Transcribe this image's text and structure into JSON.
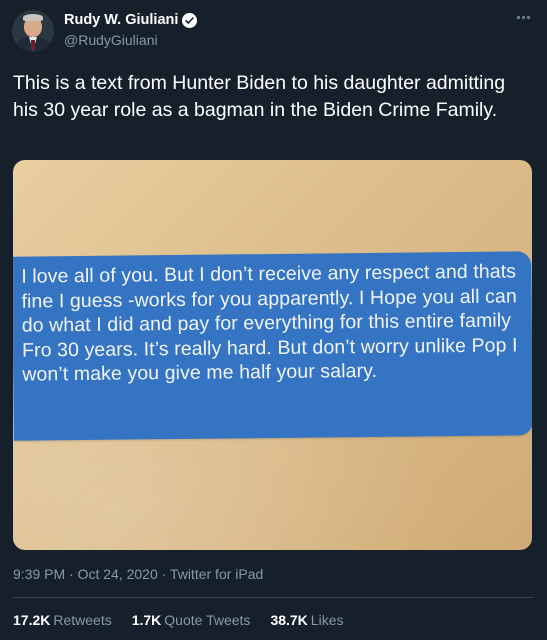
{
  "author": {
    "display_name": "Rudy W. Giuliani",
    "handle": "@RudyGiuliani",
    "verified": true
  },
  "tweet": {
    "text": "This is a text from Hunter Biden to his daughter admitting his 30 year role as a bagman in the Biden Crime Family.",
    "image_text": "I love all of you. But I don’t receive any respect and thats fine I guess -works for you apparently. I Hope you all can do what I did and pay for everything for this entire family Fro 30 years. It’s really hard. But don’t worry unlike Pop I won’t make you give me half your salary.",
    "timestamp": "9:39 PM · Oct 24, 2020 · Twitter for iPad"
  },
  "stats": [
    {
      "count": "17.2K",
      "label": "Retweets"
    },
    {
      "count": "1.7K",
      "label": "Quote Tweets"
    },
    {
      "count": "38.7K",
      "label": "Likes"
    }
  ],
  "icons": {
    "verified": "verified-badge-icon",
    "more": "more-options-icon"
  },
  "colors": {
    "background": "#15202b",
    "secondary_text": "#8899a6",
    "bubble": "#3474c2"
  }
}
